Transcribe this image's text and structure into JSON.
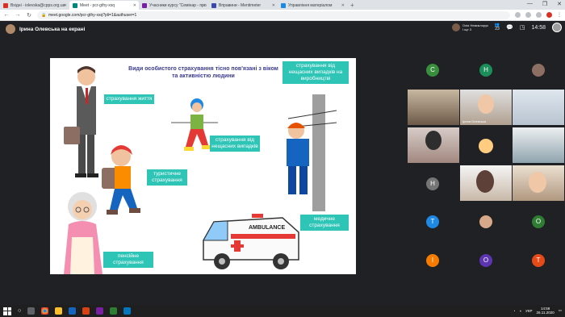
{
  "browser": {
    "tabs": [
      {
        "title": "Вхідні - iolevska@cpps.org.ua",
        "favicon_color": "#d93025",
        "active": false
      },
      {
        "title": "Meet - pcr-gthy-xsq",
        "favicon_color": "#00897b",
        "active": true
      },
      {
        "title": "Учасники курсу \"Семінар - про",
        "favicon_color": "#7b1fa2",
        "active": false
      },
      {
        "title": "Вправини - Mentimeter",
        "favicon_color": "#3949ab",
        "active": false
      },
      {
        "title": "Управління матеріалом",
        "favicon_color": "#1e88e5",
        "active": false
      }
    ],
    "url": "meet.google.com/pcr-gthy-xsq?pli=1&authuser=1"
  },
  "meet": {
    "presenter_label": "Ірина Олевська на екрані",
    "caller_name": "Олія Немиклорук",
    "caller_sub": "І ще 3",
    "participant_count": "23",
    "clock": "14:58"
  },
  "slide": {
    "title": "Види особистого страхування тісно пов'язані з віком та активністю людини",
    "boxes": {
      "life": "страхування життя",
      "accident_top": "страхування від нещасних випадків на виробництві",
      "accident_mid": "страхування від нещасних випадків",
      "tourist": "туристичне страхування",
      "medical": "медичне страхування",
      "pension": "пенсійне страхування",
      "ambulance": "AMBULANCE"
    }
  },
  "gallery": {
    "participants": [
      {
        "kind": "letter",
        "letter": "С",
        "color": "#388e3c"
      },
      {
        "kind": "letter",
        "letter": "Н",
        "color": "#1b8e5a"
      },
      {
        "kind": "photo"
      },
      {
        "kind": "cam"
      },
      {
        "kind": "cam",
        "name": "Ірина Олевська"
      },
      {
        "kind": "cam"
      },
      {
        "kind": "cam"
      },
      {
        "kind": "photo"
      },
      {
        "kind": "cam"
      },
      {
        "kind": "letter",
        "letter": "Н",
        "color": "#757575"
      },
      {
        "kind": "cam"
      },
      {
        "kind": "cam"
      },
      {
        "kind": "letter",
        "letter": "Т",
        "color": "#1e88e5"
      },
      {
        "kind": "photo"
      },
      {
        "kind": "letter",
        "letter": "О",
        "color": "#2e7d32"
      },
      {
        "kind": "letter",
        "letter": "І",
        "color": "#f57c00"
      },
      {
        "kind": "letter",
        "letter": "О",
        "color": "#5e35b1"
      },
      {
        "kind": "letter",
        "letter": "Т",
        "color": "#e64a19"
      }
    ]
  },
  "taskbar": {
    "lang": "УКР",
    "time": "14:58",
    "date": "26.11.2020"
  }
}
